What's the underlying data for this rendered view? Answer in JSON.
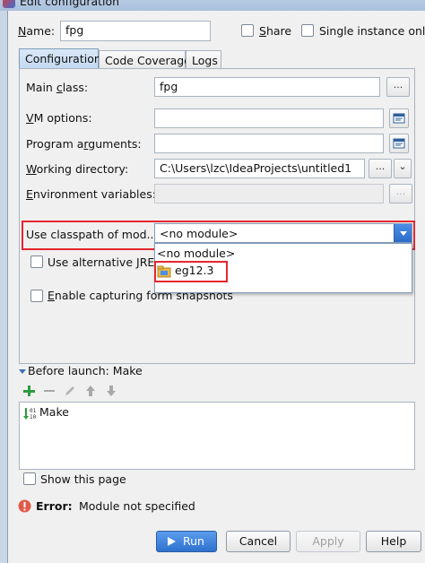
{
  "window": {
    "title": "Edit configuration"
  },
  "name": {
    "label_prefix": "",
    "label_mnemonic": "N",
    "label_rest": "ame:",
    "value": "fpg"
  },
  "share": {
    "label_mnemonic": "S",
    "label_rest": "hare",
    "checked": false
  },
  "single_instance": {
    "label": "Single instance only",
    "checked": false
  },
  "tabs": [
    {
      "label": "Configuration",
      "active": true
    },
    {
      "label": "Code Coverage",
      "active": false
    },
    {
      "label": "Logs",
      "active": false
    }
  ],
  "main_class": {
    "label_prefix": "Main ",
    "label_mnemonic": "c",
    "label_rest": "lass:",
    "value": "fpg",
    "button": "..."
  },
  "vm_options": {
    "label_prefix": "",
    "label_mnemonic": "V",
    "label_rest": "M options:",
    "value": ""
  },
  "program_arguments": {
    "label_prefix": "Program a",
    "label_mnemonic": "r",
    "label_rest": "guments:",
    "value": ""
  },
  "working_directory": {
    "label_prefix": "",
    "label_mnemonic": "W",
    "label_rest": "orking directory:",
    "value": "C:\\Users\\lzc\\IdeaProjects\\untitled1",
    "button": "...",
    "button2": "⌄"
  },
  "environment_variables": {
    "label_prefix": "",
    "label_mnemonic": "E",
    "label_rest": "nvironment variables:",
    "value": "",
    "button": "..."
  },
  "classpath_module": {
    "label": "Use classpath of mod...",
    "selected": "<no module>"
  },
  "module_dropdown": {
    "options": [
      {
        "label": "<no module>",
        "icon": ""
      },
      {
        "label": "eg12.3",
        "icon": "module-folder-icon"
      }
    ]
  },
  "alternative_jre": {
    "label_prefix": "Use alternative ",
    "label_mnemonic": "J",
    "label_rest": "RE:",
    "checked": false
  },
  "form_snapshots": {
    "label_prefix": "",
    "label_mnemonic": "E",
    "label_rest": "nable capturing form snapshots",
    "checked": false
  },
  "before_launch": {
    "label": "Before launch: Make",
    "items": [
      {
        "label": "Make"
      }
    ]
  },
  "show_page": {
    "label": "Show this page",
    "checked": false
  },
  "error": {
    "label": "Error:",
    "message": "Module not specified"
  },
  "buttons": {
    "run": "Run",
    "cancel": "Cancel",
    "apply": "Apply",
    "help": "Help"
  },
  "colors": {
    "highlight_red": "#e6262f",
    "accent_blue": "#2f72cf",
    "add_green": "#2e9b3c",
    "error_red": "#e05a4a"
  }
}
